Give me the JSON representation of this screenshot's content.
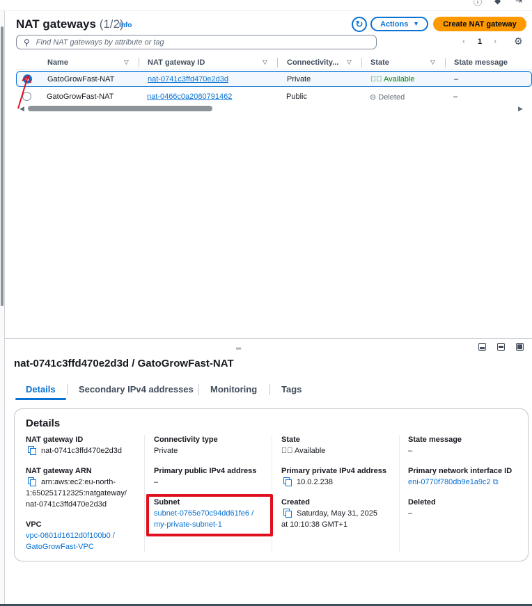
{
  "page": {
    "title": "NAT gateways",
    "count": "(1/2)",
    "info": "Info",
    "actions_label": "Actions",
    "create_label": "Create NAT gateway",
    "search_placeholder": "Find NAT gateways by attribute or tag",
    "page_number": "1"
  },
  "table": {
    "columns": [
      "Name",
      "NAT gateway ID",
      "Connectivity...",
      "State",
      "State message"
    ],
    "rows": [
      {
        "name": "GatoGrowFast-NAT",
        "id": "nat-0741c3ffd470e2d3d",
        "connectivity": "Private",
        "state": "Available",
        "message": "–",
        "selected": true
      },
      {
        "name": "GatoGrowFast-NAT",
        "id": "nat-0466c0a2080791462",
        "connectivity": "Public",
        "state": "Deleted",
        "message": "–",
        "selected": false
      }
    ]
  },
  "detail": {
    "title": "nat-0741c3ffd470e2d3d / GatoGrowFast-NAT",
    "tabs": [
      "Details",
      "Secondary IPv4 addresses",
      "Monitoring",
      "Tags"
    ],
    "section_title": "Details",
    "fields": {
      "nat_id_label": "NAT gateway ID",
      "nat_id_value": "nat-0741c3ffd470e2d3d",
      "arn_label": "NAT gateway ARN",
      "arn_line1": "arn:aws:ec2:eu-north-",
      "arn_line2": "1:650251712325:natgateway/",
      "arn_line3": "nat-0741c3ffd470e2d3d",
      "vpc_label": "VPC",
      "vpc_line1": "vpc-0601d1612d0f100b0 /",
      "vpc_line2": "GatoGrowFast-VPC",
      "conn_label": "Connectivity type",
      "conn_value": "Private",
      "pub_ip_label": "Primary public IPv4 address",
      "pub_ip_value": "–",
      "subnet_label": "Subnet",
      "subnet_line1": "subnet-0765e70c94dd61fe6 /",
      "subnet_line2": "my-private-subnet-1",
      "state_label": "State",
      "state_value": "Available",
      "priv_ip_label": "Primary private IPv4 address",
      "priv_ip_value": "10.0.2.238",
      "created_label": "Created",
      "created_line1": "Saturday, May 31, 2025",
      "created_line2": "at 10:10:38 GMT+1",
      "msg_label": "State message",
      "msg_value": "–",
      "eni_label": "Primary network interface ID",
      "eni_value": "eni-0770f780db9e1a9c2",
      "deleted_label": "Deleted",
      "deleted_value": "–"
    }
  },
  "colors": {
    "accent": "#0972d3",
    "primary_button": "#ff9900",
    "success": "#037f0c",
    "highlight": "#e0101f"
  },
  "icons": [
    "refresh-icon",
    "search-icon",
    "settings-gear-icon",
    "copy-icon",
    "external-link-icon",
    "status-available-icon",
    "status-deleted-icon"
  ]
}
